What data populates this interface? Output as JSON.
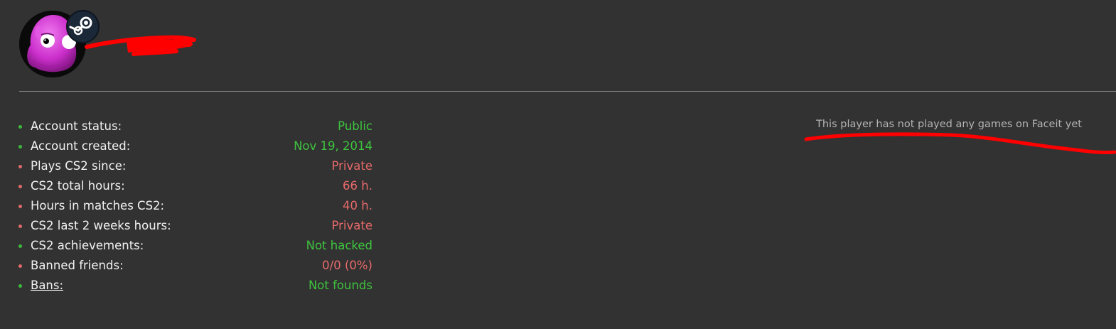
{
  "profile": {
    "avatar_icon": "pink-blob-monster-avatar",
    "steam_icon": "steam-logo-icon",
    "name_redacted_mark": "red-scribble"
  },
  "stats": [
    {
      "label": "Account status:",
      "value": "Public",
      "status": "ok",
      "link": false
    },
    {
      "label": "Account created:",
      "value": "Nov 19, 2014",
      "status": "ok",
      "link": false
    },
    {
      "label": "Plays CS2 since:",
      "value": "Private",
      "status": "bad",
      "link": false
    },
    {
      "label": "CS2 total hours:",
      "value": "66 h.",
      "status": "bad",
      "link": false
    },
    {
      "label": "Hours in matches CS2:",
      "value": "40 h.",
      "status": "bad",
      "link": false
    },
    {
      "label": "CS2 last 2 weeks hours:",
      "value": "Private",
      "status": "bad",
      "link": false
    },
    {
      "label": "CS2 achievements:",
      "value": "Not hacked",
      "status": "ok",
      "link": false
    },
    {
      "label": "Banned friends:",
      "value": "0/0 (0%)",
      "status": "bad",
      "link": false
    },
    {
      "label": "Bans:",
      "value": "Not founds",
      "status": "ok",
      "link": true
    }
  ],
  "faceit": {
    "message": "This player has not played any games on Faceit yet"
  },
  "colors": {
    "background": "#323232",
    "ok": "#3ec43e",
    "bad": "#e86a6a",
    "scribble": "#ff0000"
  }
}
